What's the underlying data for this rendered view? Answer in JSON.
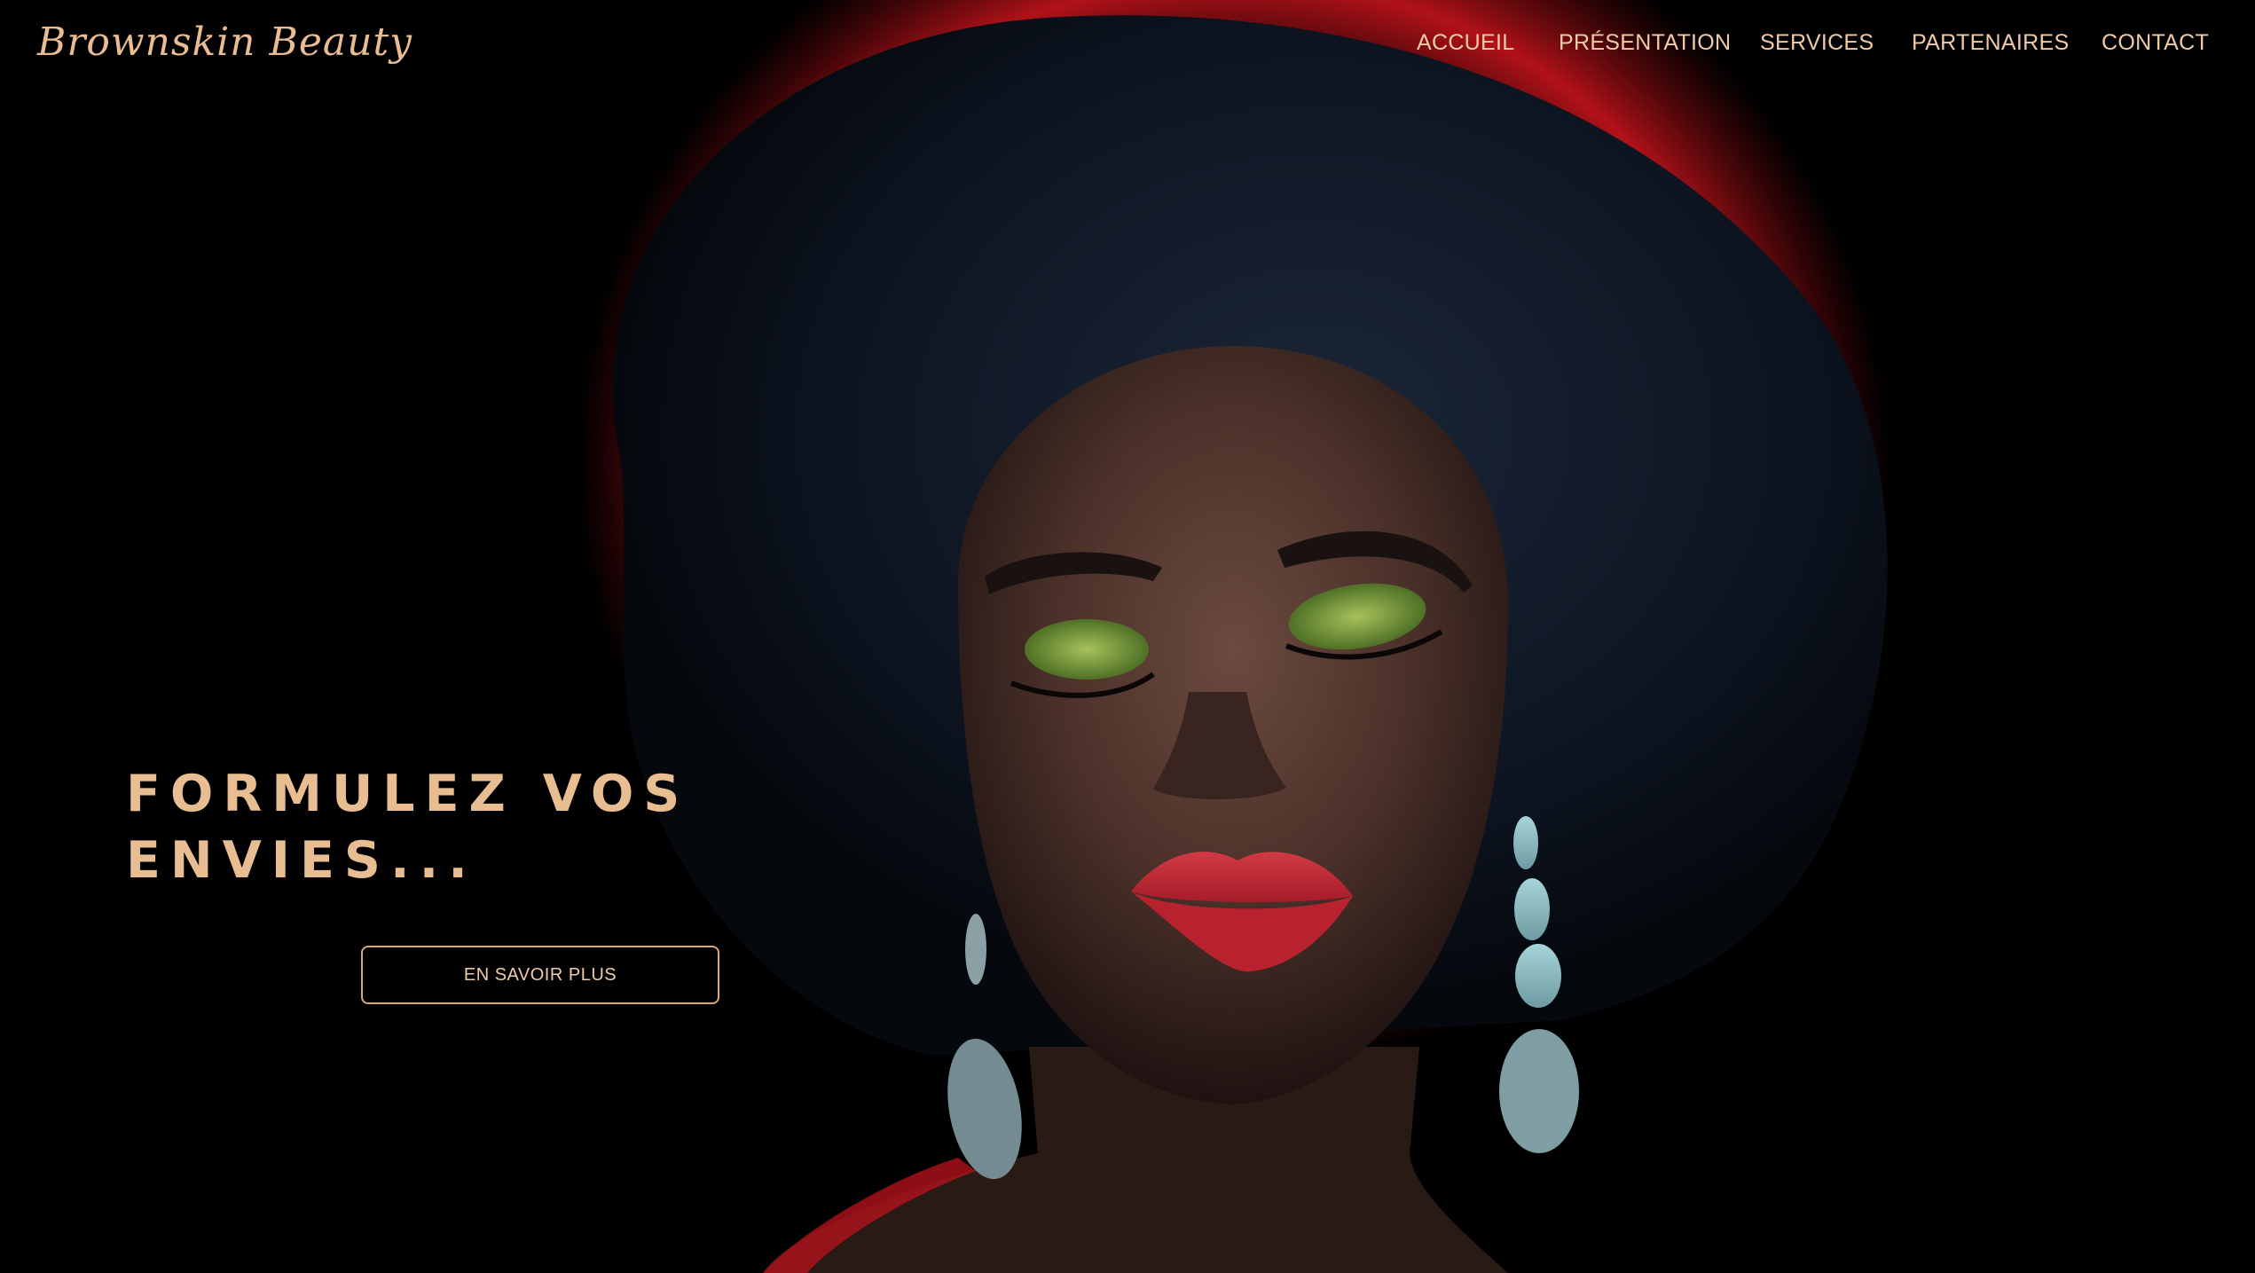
{
  "brand": {
    "logo_text": "Brownskin Beauty",
    "accent_color": "#e9bd92"
  },
  "nav": {
    "items": [
      {
        "label": "ACCUEIL"
      },
      {
        "label": "PRÉSENTATION"
      },
      {
        "label": "SERVICES"
      },
      {
        "label": "PARTENAIRES"
      },
      {
        "label": "CONTACT"
      }
    ]
  },
  "hero": {
    "headline_line1": "FORMULEZ VOS",
    "headline_line2": "ENVIES...",
    "cta_label": "EN SAVOIR PLUS"
  }
}
